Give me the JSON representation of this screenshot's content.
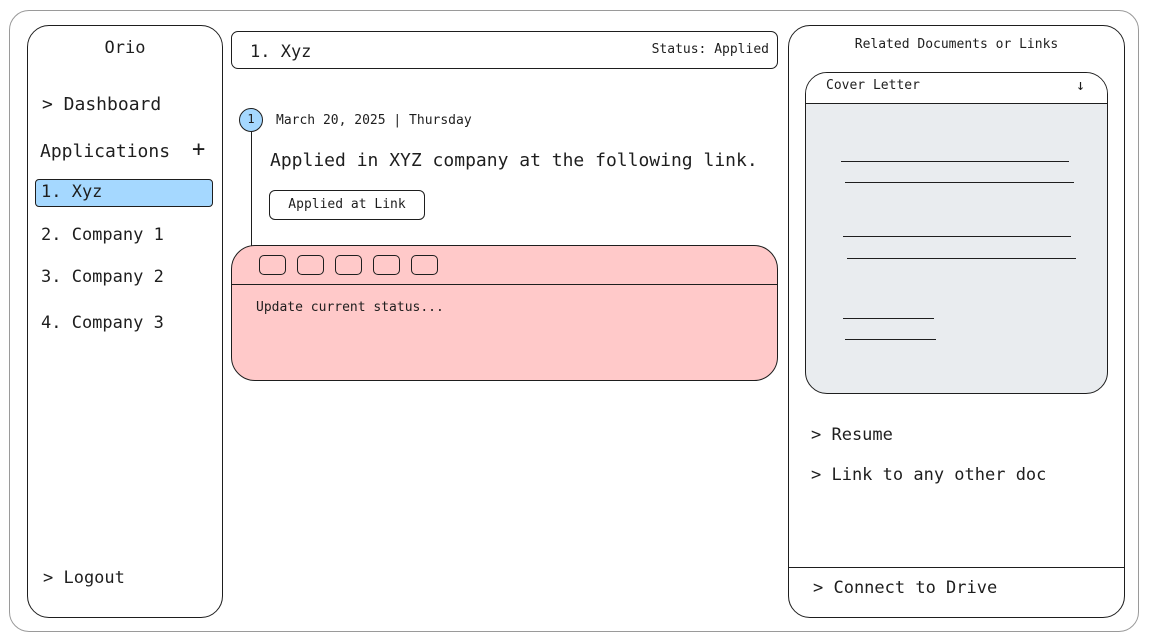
{
  "sidebar": {
    "app_title": "Orio",
    "dashboard_label": "> Dashboard",
    "applications_label": "Applications",
    "add_label": "+",
    "items": [
      {
        "label": "1. Xyz"
      },
      {
        "label": "2. Company 1"
      },
      {
        "label": "3. Company 2"
      },
      {
        "label": "4. Company 3"
      }
    ],
    "logout_label": "> Logout"
  },
  "header": {
    "title": "1. Xyz",
    "status": "Status: Applied"
  },
  "timeline": {
    "entries": [
      {
        "number": "1",
        "date": "March 20, 2025 | Thursday",
        "text": "Applied in XYZ company at the following link.",
        "link_label": "Applied at Link"
      }
    ]
  },
  "update": {
    "placeholder": "Update current status..."
  },
  "related": {
    "title": "Related Documents or Links",
    "cover_letter": {
      "title": "Cover Letter",
      "arrow": "↓"
    },
    "links": [
      {
        "label": "> Resume"
      },
      {
        "label": "> Link to any other doc"
      }
    ],
    "connect_label": "> Connect to Drive"
  },
  "colors": {
    "selected": "#a5d8ff",
    "update_box": "#ffc9c9",
    "doc_card": "#e9ecef",
    "timeline_dot": "#a5d8ff"
  }
}
